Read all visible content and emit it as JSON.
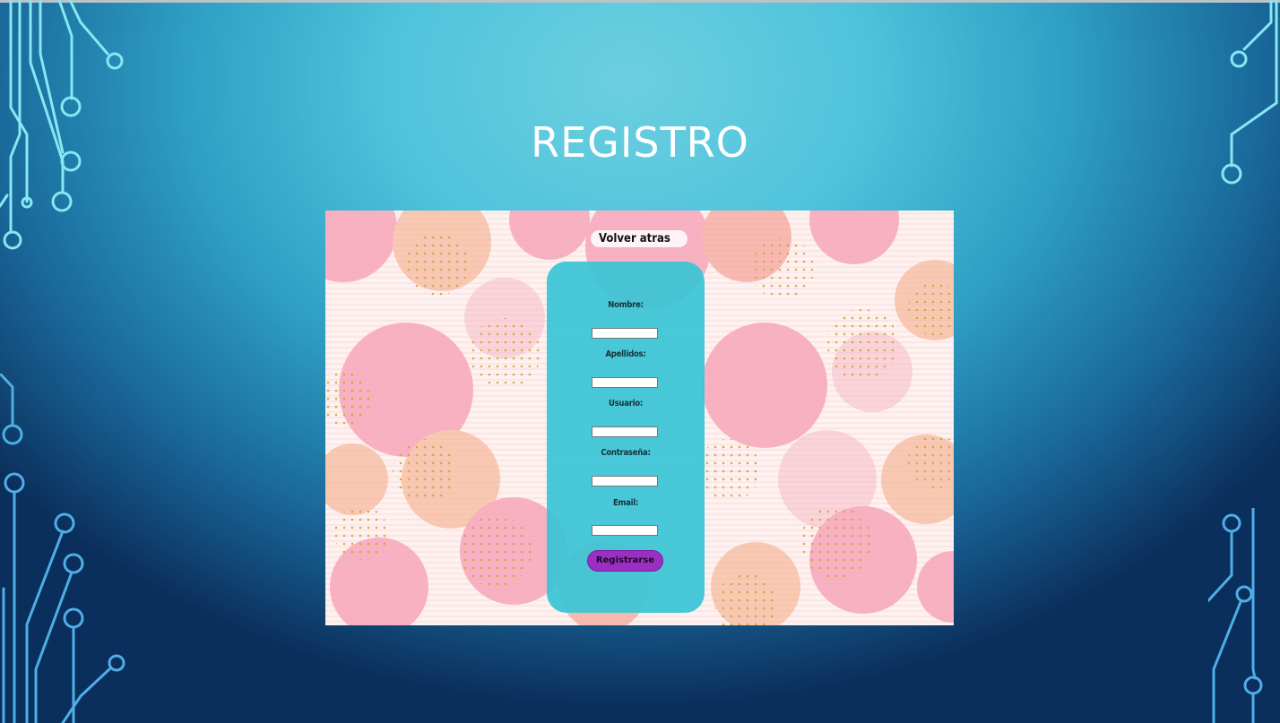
{
  "slide": {
    "title": "REGISTRO"
  },
  "app": {
    "back_link": "Volver atras",
    "form": {
      "fields": [
        {
          "label": "Nombre:",
          "value": ""
        },
        {
          "label": "Apellidos:",
          "value": ""
        },
        {
          "label": "Usuario:",
          "value": ""
        },
        {
          "label": "Contraseña:",
          "value": ""
        },
        {
          "label": "Email:",
          "value": ""
        }
      ],
      "submit_label": "Registrarse"
    }
  },
  "colors": {
    "slide_accent": "#4ec3db",
    "circuit_left_top": "#7fe6f2",
    "circuit_bottom": "#4aa7e0",
    "form_card": "#38c4d6",
    "submit_button": "#9b2fc4",
    "pattern_pink": "#f7a6bb",
    "pattern_peach": "#f8c3a8"
  }
}
